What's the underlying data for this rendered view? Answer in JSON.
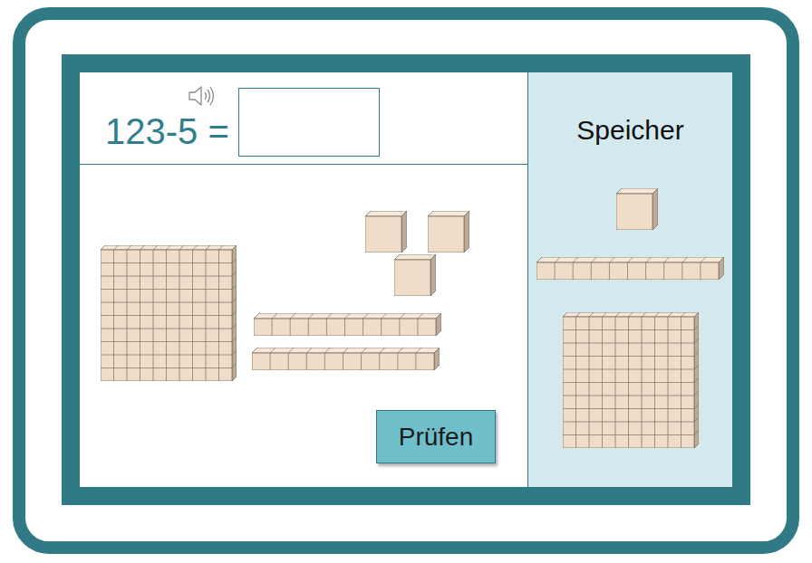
{
  "exercise": {
    "equation": "123-5 =",
    "answer": {
      "value": ""
    }
  },
  "workspace": {
    "blocks": [
      {
        "kind": "hundred"
      },
      {
        "kind": "ten"
      },
      {
        "kind": "ten"
      },
      {
        "kind": "one"
      },
      {
        "kind": "one"
      },
      {
        "kind": "one"
      }
    ]
  },
  "check_button": {
    "label": "Prüfen"
  },
  "storage": {
    "title": "Speicher",
    "items": [
      {
        "kind": "one"
      },
      {
        "kind": "ten"
      },
      {
        "kind": "hundred"
      }
    ]
  }
}
